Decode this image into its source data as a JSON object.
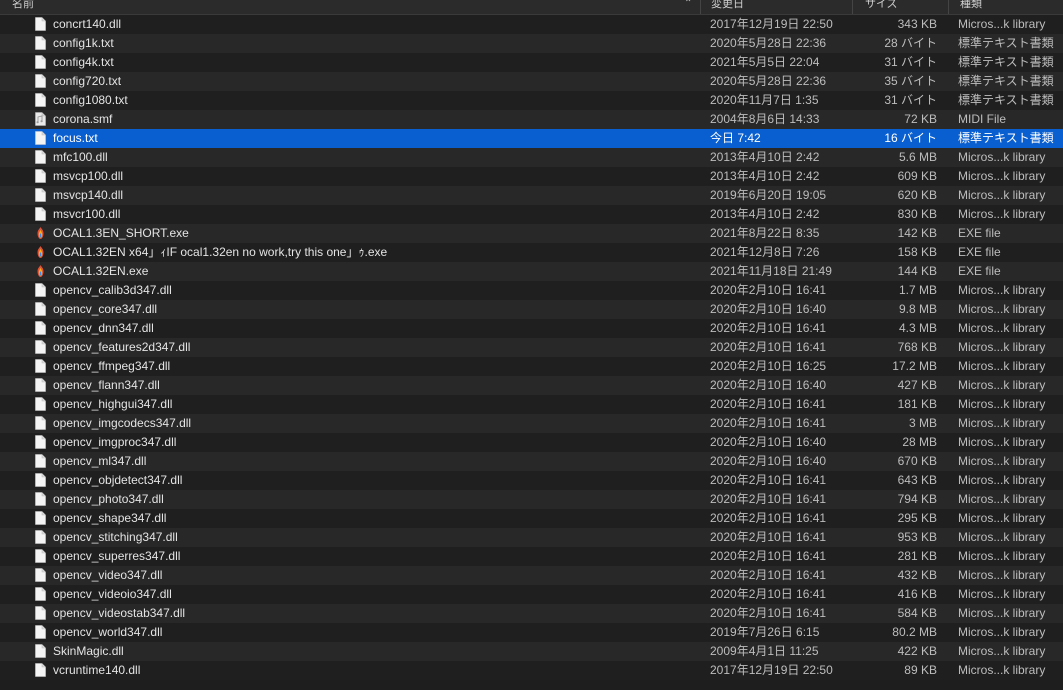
{
  "header": {
    "name": "名前",
    "date": "変更日",
    "size": "サイズ",
    "kind": "種類"
  },
  "files": [
    {
      "name": "concrt140.dll",
      "date": "2017年12月19日 22:50",
      "size": "343 KB",
      "kind": "Micros...k library",
      "icon": "document-icon"
    },
    {
      "name": "config1k.txt",
      "date": "2020年5月28日 22:36",
      "size": "28 バイト",
      "kind": "標準テキスト書類",
      "icon": "document-icon"
    },
    {
      "name": "config4k.txt",
      "date": "2021年5月5日 22:04",
      "size": "31 バイト",
      "kind": "標準テキスト書類",
      "icon": "document-icon"
    },
    {
      "name": "config720.txt",
      "date": "2020年5月28日 22:36",
      "size": "35 バイト",
      "kind": "標準テキスト書類",
      "icon": "document-icon"
    },
    {
      "name": "config1080.txt",
      "date": "2020年11月7日 1:35",
      "size": "31 バイト",
      "kind": "標準テキスト書類",
      "icon": "document-icon"
    },
    {
      "name": "corona.smf",
      "date": "2004年8月6日 14:33",
      "size": "72 KB",
      "kind": "MIDI File",
      "icon": "midi-file-icon"
    },
    {
      "name": "focus.txt",
      "date": "今日 7:42",
      "size": "16 バイト",
      "kind": "標準テキスト書類",
      "icon": "document-icon"
    },
    {
      "name": "mfc100.dll",
      "date": "2013年4月10日 2:42",
      "size": "5.6 MB",
      "kind": "Micros...k library",
      "icon": "document-icon"
    },
    {
      "name": "msvcp100.dll",
      "date": "2013年4月10日 2:42",
      "size": "609 KB",
      "kind": "Micros...k library",
      "icon": "document-icon"
    },
    {
      "name": "msvcp140.dll",
      "date": "2019年6月20日 19:05",
      "size": "620 KB",
      "kind": "Micros...k library",
      "icon": "document-icon"
    },
    {
      "name": "msvcr100.dll",
      "date": "2013年4月10日 2:42",
      "size": "830 KB",
      "kind": "Micros...k library",
      "icon": "document-icon"
    },
    {
      "name": "OCAL1.3EN_SHORT.exe",
      "date": "2021年8月22日 8:35",
      "size": "142 KB",
      "kind": "EXE file",
      "icon": "exe-icon"
    },
    {
      "name": "OCAL1.32EN x64」ｨIF ocal1.32en no work,try this one」ｩ.exe",
      "date": "2021年12月8日 7:26",
      "size": "158 KB",
      "kind": "EXE file",
      "icon": "exe-icon"
    },
    {
      "name": "OCAL1.32EN.exe",
      "date": "2021年11月18日 21:49",
      "size": "144 KB",
      "kind": "EXE file",
      "icon": "exe-icon"
    },
    {
      "name": "opencv_calib3d347.dll",
      "date": "2020年2月10日 16:41",
      "size": "1.7 MB",
      "kind": "Micros...k library",
      "icon": "document-icon"
    },
    {
      "name": "opencv_core347.dll",
      "date": "2020年2月10日 16:40",
      "size": "9.8 MB",
      "kind": "Micros...k library",
      "icon": "document-icon"
    },
    {
      "name": "opencv_dnn347.dll",
      "date": "2020年2月10日 16:41",
      "size": "4.3 MB",
      "kind": "Micros...k library",
      "icon": "document-icon"
    },
    {
      "name": "opencv_features2d347.dll",
      "date": "2020年2月10日 16:41",
      "size": "768 KB",
      "kind": "Micros...k library",
      "icon": "document-icon"
    },
    {
      "name": "opencv_ffmpeg347.dll",
      "date": "2020年2月10日 16:25",
      "size": "17.2 MB",
      "kind": "Micros...k library",
      "icon": "document-icon"
    },
    {
      "name": "opencv_flann347.dll",
      "date": "2020年2月10日 16:40",
      "size": "427 KB",
      "kind": "Micros...k library",
      "icon": "document-icon"
    },
    {
      "name": "opencv_highgui347.dll",
      "date": "2020年2月10日 16:41",
      "size": "181 KB",
      "kind": "Micros...k library",
      "icon": "document-icon"
    },
    {
      "name": "opencv_imgcodecs347.dll",
      "date": "2020年2月10日 16:41",
      "size": "3 MB",
      "kind": "Micros...k library",
      "icon": "document-icon"
    },
    {
      "name": "opencv_imgproc347.dll",
      "date": "2020年2月10日 16:40",
      "size": "28 MB",
      "kind": "Micros...k library",
      "icon": "document-icon"
    },
    {
      "name": "opencv_ml347.dll",
      "date": "2020年2月10日 16:40",
      "size": "670 KB",
      "kind": "Micros...k library",
      "icon": "document-icon"
    },
    {
      "name": "opencv_objdetect347.dll",
      "date": "2020年2月10日 16:41",
      "size": "643 KB",
      "kind": "Micros...k library",
      "icon": "document-icon"
    },
    {
      "name": "opencv_photo347.dll",
      "date": "2020年2月10日 16:41",
      "size": "794 KB",
      "kind": "Micros...k library",
      "icon": "document-icon"
    },
    {
      "name": "opencv_shape347.dll",
      "date": "2020年2月10日 16:41",
      "size": "295 KB",
      "kind": "Micros...k library",
      "icon": "document-icon"
    },
    {
      "name": "opencv_stitching347.dll",
      "date": "2020年2月10日 16:41",
      "size": "953 KB",
      "kind": "Micros...k library",
      "icon": "document-icon"
    },
    {
      "name": "opencv_superres347.dll",
      "date": "2020年2月10日 16:41",
      "size": "281 KB",
      "kind": "Micros...k library",
      "icon": "document-icon"
    },
    {
      "name": "opencv_video347.dll",
      "date": "2020年2月10日 16:41",
      "size": "432 KB",
      "kind": "Micros...k library",
      "icon": "document-icon"
    },
    {
      "name": "opencv_videoio347.dll",
      "date": "2020年2月10日 16:41",
      "size": "416 KB",
      "kind": "Micros...k library",
      "icon": "document-icon"
    },
    {
      "name": "opencv_videostab347.dll",
      "date": "2020年2月10日 16:41",
      "size": "584 KB",
      "kind": "Micros...k library",
      "icon": "document-icon"
    },
    {
      "name": "opencv_world347.dll",
      "date": "2019年7月26日 6:15",
      "size": "80.2 MB",
      "kind": "Micros...k library",
      "icon": "document-icon"
    },
    {
      "name": "SkinMagic.dll",
      "date": "2009年4月1日 11:25",
      "size": "422 KB",
      "kind": "Micros...k library",
      "icon": "document-icon"
    },
    {
      "name": "vcruntime140.dll",
      "date": "2017年12月19日 22:50",
      "size": "89 KB",
      "kind": "Micros...k library",
      "icon": "document-icon"
    }
  ],
  "selected_index": 6,
  "colors": {
    "background": "#1e1e1e",
    "selection": "#0a5fd0",
    "text": "#e4e4e4",
    "secondary_text": "#bdbdbd"
  }
}
